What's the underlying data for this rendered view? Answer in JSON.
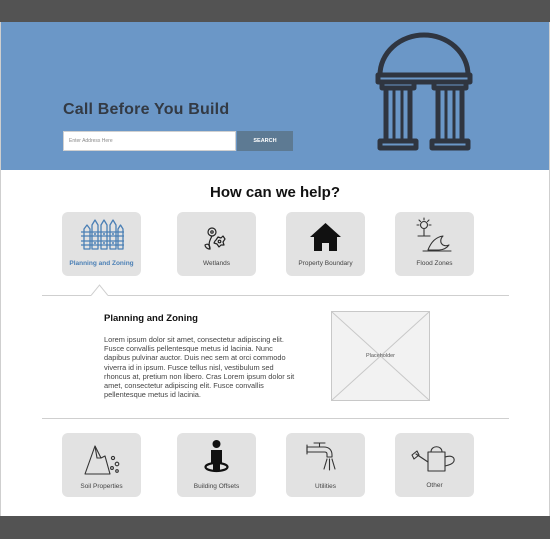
{
  "hero": {
    "title": "Call Before You Build",
    "search_placeholder": "Enter Address Here",
    "search_button": "SEARCH",
    "logo_icon": "dome-columns-icon",
    "background_color": "#6b97c7"
  },
  "help": {
    "title": "How can we help?"
  },
  "categories_top": [
    {
      "label": "Planning and Zoning",
      "icon": "fence-icon",
      "active": true
    },
    {
      "label": "Wetlands",
      "icon": "flower-icon",
      "active": false
    },
    {
      "label": "Property Boundary",
      "icon": "house-icon",
      "active": false
    },
    {
      "label": "Flood Zones",
      "icon": "flood-wave-icon",
      "active": false
    }
  ],
  "panel": {
    "title": "Planning and Zoning",
    "body": "Lorem ipsum dolor sit amet, consectetur adipiscing elit. Fusce convallis pellentesque metus id lacinia. Nunc dapibus pulvinar auctor. Duis nec sem at orci commodo viverra id in ipsum. Fusce tellus nisl, vestibulum sed rhoncus at, pretium non libero. Cras Lorem ipsum dolor sit amet, consectetur adipiscing elit. Fusce convallis pellentesque metus id lacinia.",
    "image_label": "Placeholder"
  },
  "categories_bottom": [
    {
      "label": "Soil Properties",
      "icon": "soil-mound-icon"
    },
    {
      "label": "Building Offsets",
      "icon": "person-marker-icon"
    },
    {
      "label": "Utilities",
      "icon": "faucet-icon"
    },
    {
      "label": "Other",
      "icon": "watering-can-icon"
    }
  ],
  "colors": {
    "accent": "#4a7fb5",
    "header_bar": "#535353",
    "tile": "#e2e2e2",
    "search_button": "#5d7a93"
  }
}
